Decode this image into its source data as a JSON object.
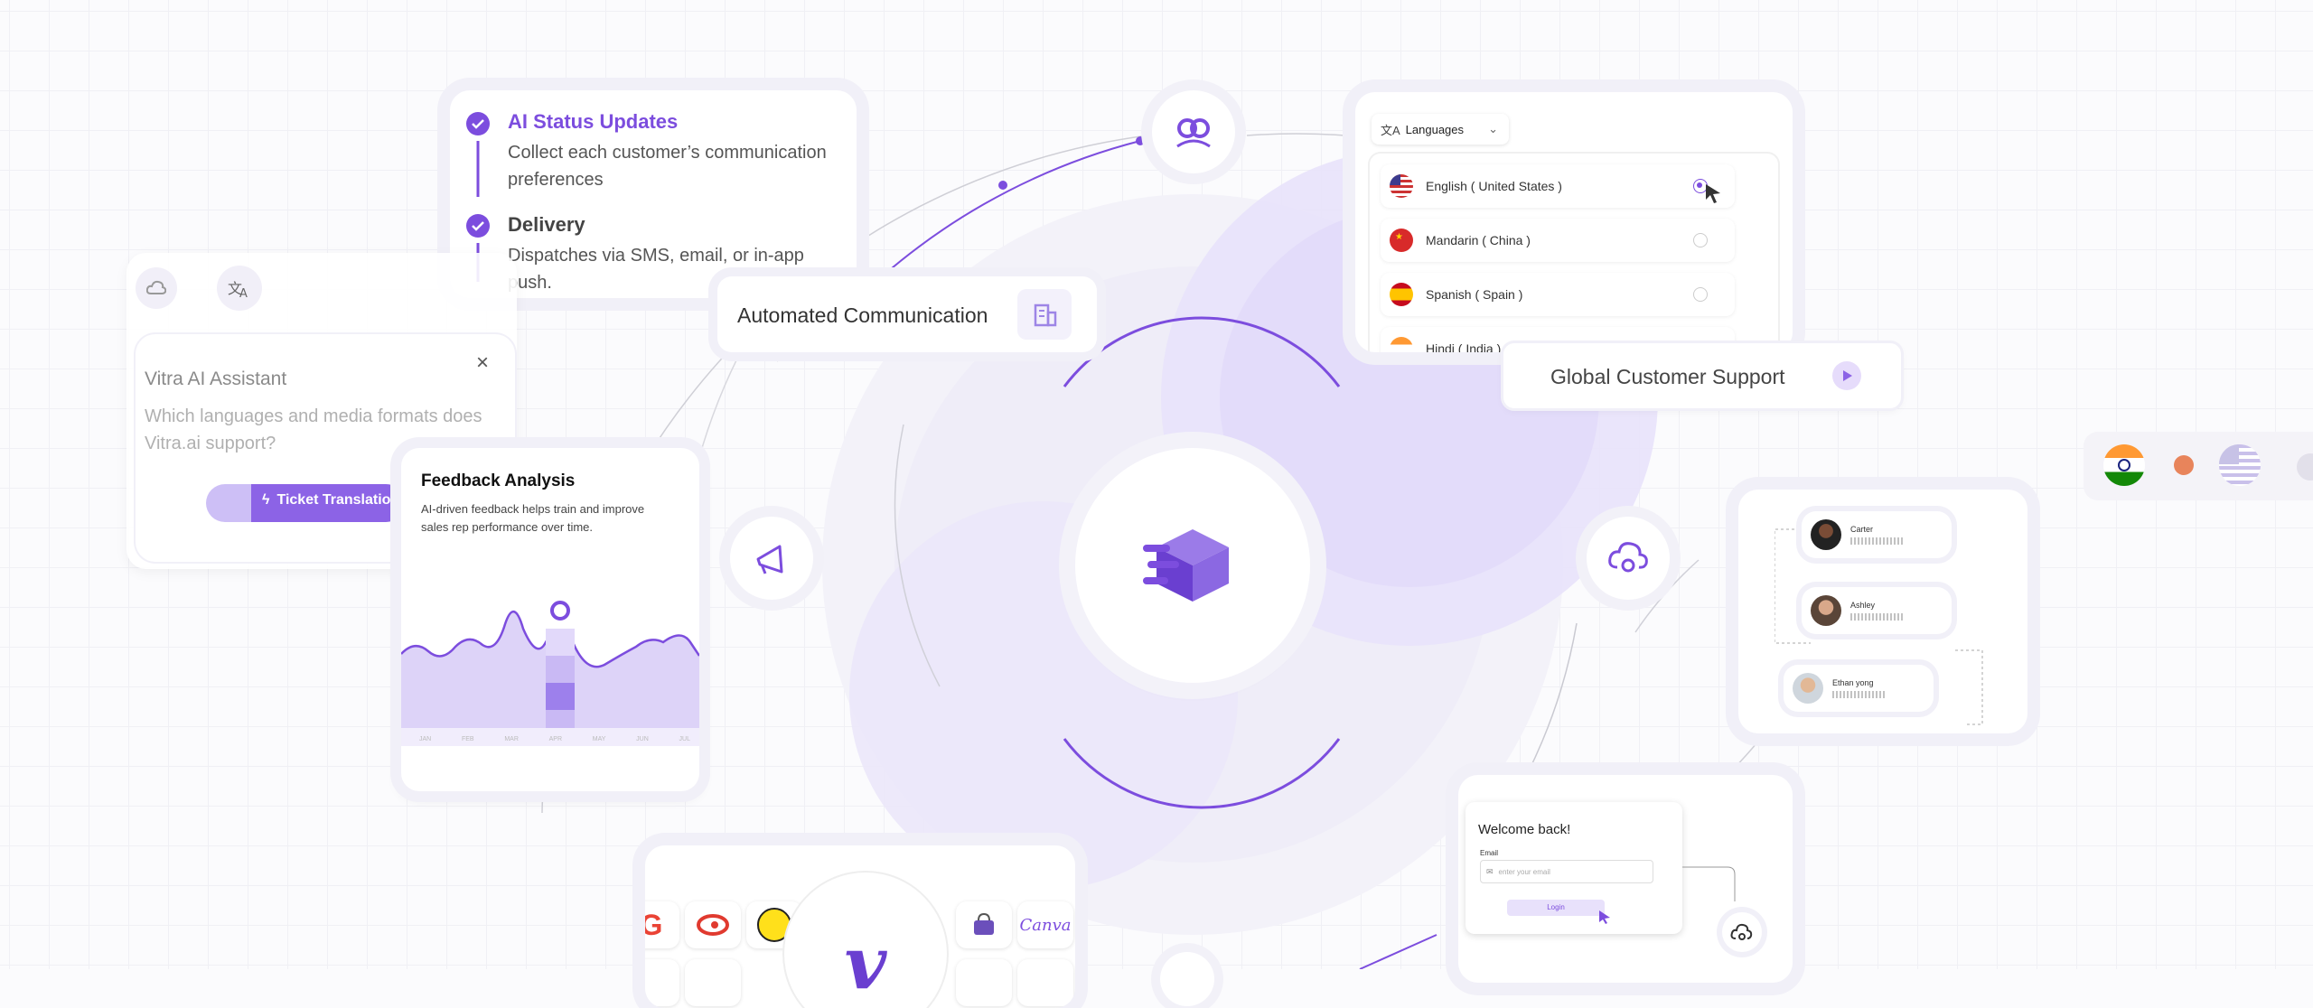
{
  "status_card": {
    "step1_title": "AI Status Updates",
    "step1_desc": "Collect each customer’s communication preferences",
    "step2_title": "Delivery",
    "step2_desc": "Dispatches via SMS, email, or in-app push."
  },
  "automated_communication": {
    "label": "Automated Communication"
  },
  "assistant": {
    "title": "Vitra AI Assistant",
    "question": "Which languages and media formats does Vitra.ai support?",
    "button": "Ticket Translation"
  },
  "feedback": {
    "title": "Feedback Analysis",
    "desc": "AI-driven feedback helps train and improve sales rep performance over time.",
    "months": [
      "JAN",
      "FEB",
      "MAR",
      "APR",
      "MAY",
      "JUN",
      "JUL"
    ]
  },
  "languages": {
    "dropdown_label": "Languages",
    "items": [
      {
        "label": "English ( United States )",
        "selected": true
      },
      {
        "label": "Mandarin ( China )",
        "selected": false
      },
      {
        "label": "Spanish ( Spain )",
        "selected": false
      },
      {
        "label": "Hindi ( India )",
        "selected": false
      }
    ]
  },
  "global_support": {
    "label": "Global Customer Support"
  },
  "people": [
    {
      "name": "Carter"
    },
    {
      "name": "Ashley"
    },
    {
      "name": "Ethan yong"
    }
  ],
  "login": {
    "title": "Welcome back!",
    "email_label": "Email",
    "email_placeholder": "enter your email",
    "button": "Login"
  },
  "integrations": {
    "canva_label": "Canva"
  },
  "colors": {
    "accent": "#7c4dde",
    "accent_light": "#e8e1fb",
    "bg": "#fbfbfd"
  }
}
